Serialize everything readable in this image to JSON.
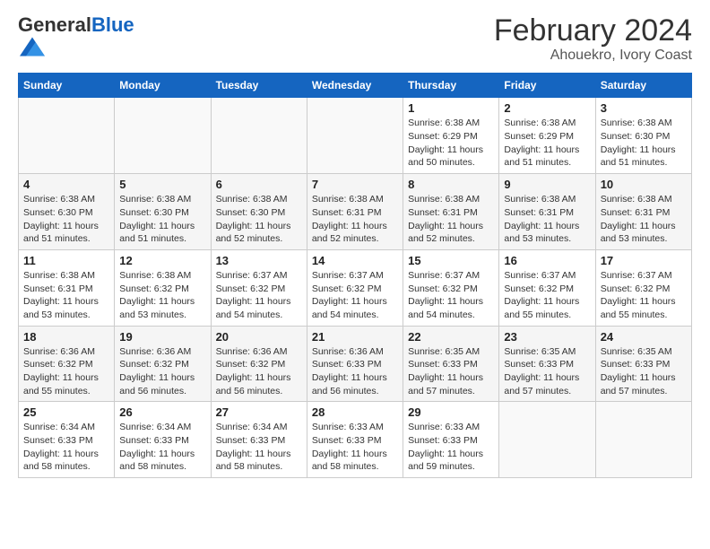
{
  "logo": {
    "general": "General",
    "blue": "Blue"
  },
  "title": "February 2024",
  "subtitle": "Ahouekro, Ivory Coast",
  "days_of_week": [
    "Sunday",
    "Monday",
    "Tuesday",
    "Wednesday",
    "Thursday",
    "Friday",
    "Saturday"
  ],
  "weeks": [
    [
      {
        "day": "",
        "detail": "",
        "empty": true
      },
      {
        "day": "",
        "detail": "",
        "empty": true
      },
      {
        "day": "",
        "detail": "",
        "empty": true
      },
      {
        "day": "",
        "detail": "",
        "empty": true
      },
      {
        "day": "1",
        "detail": "Sunrise: 6:38 AM\nSunset: 6:29 PM\nDaylight: 11 hours\nand 50 minutes."
      },
      {
        "day": "2",
        "detail": "Sunrise: 6:38 AM\nSunset: 6:29 PM\nDaylight: 11 hours\nand 51 minutes."
      },
      {
        "day": "3",
        "detail": "Sunrise: 6:38 AM\nSunset: 6:30 PM\nDaylight: 11 hours\nand 51 minutes."
      }
    ],
    [
      {
        "day": "4",
        "detail": "Sunrise: 6:38 AM\nSunset: 6:30 PM\nDaylight: 11 hours\nand 51 minutes."
      },
      {
        "day": "5",
        "detail": "Sunrise: 6:38 AM\nSunset: 6:30 PM\nDaylight: 11 hours\nand 51 minutes."
      },
      {
        "day": "6",
        "detail": "Sunrise: 6:38 AM\nSunset: 6:30 PM\nDaylight: 11 hours\nand 52 minutes."
      },
      {
        "day": "7",
        "detail": "Sunrise: 6:38 AM\nSunset: 6:31 PM\nDaylight: 11 hours\nand 52 minutes."
      },
      {
        "day": "8",
        "detail": "Sunrise: 6:38 AM\nSunset: 6:31 PM\nDaylight: 11 hours\nand 52 minutes."
      },
      {
        "day": "9",
        "detail": "Sunrise: 6:38 AM\nSunset: 6:31 PM\nDaylight: 11 hours\nand 53 minutes."
      },
      {
        "day": "10",
        "detail": "Sunrise: 6:38 AM\nSunset: 6:31 PM\nDaylight: 11 hours\nand 53 minutes."
      }
    ],
    [
      {
        "day": "11",
        "detail": "Sunrise: 6:38 AM\nSunset: 6:31 PM\nDaylight: 11 hours\nand 53 minutes."
      },
      {
        "day": "12",
        "detail": "Sunrise: 6:38 AM\nSunset: 6:32 PM\nDaylight: 11 hours\nand 53 minutes."
      },
      {
        "day": "13",
        "detail": "Sunrise: 6:37 AM\nSunset: 6:32 PM\nDaylight: 11 hours\nand 54 minutes."
      },
      {
        "day": "14",
        "detail": "Sunrise: 6:37 AM\nSunset: 6:32 PM\nDaylight: 11 hours\nand 54 minutes."
      },
      {
        "day": "15",
        "detail": "Sunrise: 6:37 AM\nSunset: 6:32 PM\nDaylight: 11 hours\nand 54 minutes."
      },
      {
        "day": "16",
        "detail": "Sunrise: 6:37 AM\nSunset: 6:32 PM\nDaylight: 11 hours\nand 55 minutes."
      },
      {
        "day": "17",
        "detail": "Sunrise: 6:37 AM\nSunset: 6:32 PM\nDaylight: 11 hours\nand 55 minutes."
      }
    ],
    [
      {
        "day": "18",
        "detail": "Sunrise: 6:36 AM\nSunset: 6:32 PM\nDaylight: 11 hours\nand 55 minutes."
      },
      {
        "day": "19",
        "detail": "Sunrise: 6:36 AM\nSunset: 6:32 PM\nDaylight: 11 hours\nand 56 minutes."
      },
      {
        "day": "20",
        "detail": "Sunrise: 6:36 AM\nSunset: 6:32 PM\nDaylight: 11 hours\nand 56 minutes."
      },
      {
        "day": "21",
        "detail": "Sunrise: 6:36 AM\nSunset: 6:33 PM\nDaylight: 11 hours\nand 56 minutes."
      },
      {
        "day": "22",
        "detail": "Sunrise: 6:35 AM\nSunset: 6:33 PM\nDaylight: 11 hours\nand 57 minutes."
      },
      {
        "day": "23",
        "detail": "Sunrise: 6:35 AM\nSunset: 6:33 PM\nDaylight: 11 hours\nand 57 minutes."
      },
      {
        "day": "24",
        "detail": "Sunrise: 6:35 AM\nSunset: 6:33 PM\nDaylight: 11 hours\nand 57 minutes."
      }
    ],
    [
      {
        "day": "25",
        "detail": "Sunrise: 6:34 AM\nSunset: 6:33 PM\nDaylight: 11 hours\nand 58 minutes."
      },
      {
        "day": "26",
        "detail": "Sunrise: 6:34 AM\nSunset: 6:33 PM\nDaylight: 11 hours\nand 58 minutes."
      },
      {
        "day": "27",
        "detail": "Sunrise: 6:34 AM\nSunset: 6:33 PM\nDaylight: 11 hours\nand 58 minutes."
      },
      {
        "day": "28",
        "detail": "Sunrise: 6:33 AM\nSunset: 6:33 PM\nDaylight: 11 hours\nand 58 minutes."
      },
      {
        "day": "29",
        "detail": "Sunrise: 6:33 AM\nSunset: 6:33 PM\nDaylight: 11 hours\nand 59 minutes."
      },
      {
        "day": "",
        "detail": "",
        "empty": true
      },
      {
        "day": "",
        "detail": "",
        "empty": true
      }
    ]
  ]
}
